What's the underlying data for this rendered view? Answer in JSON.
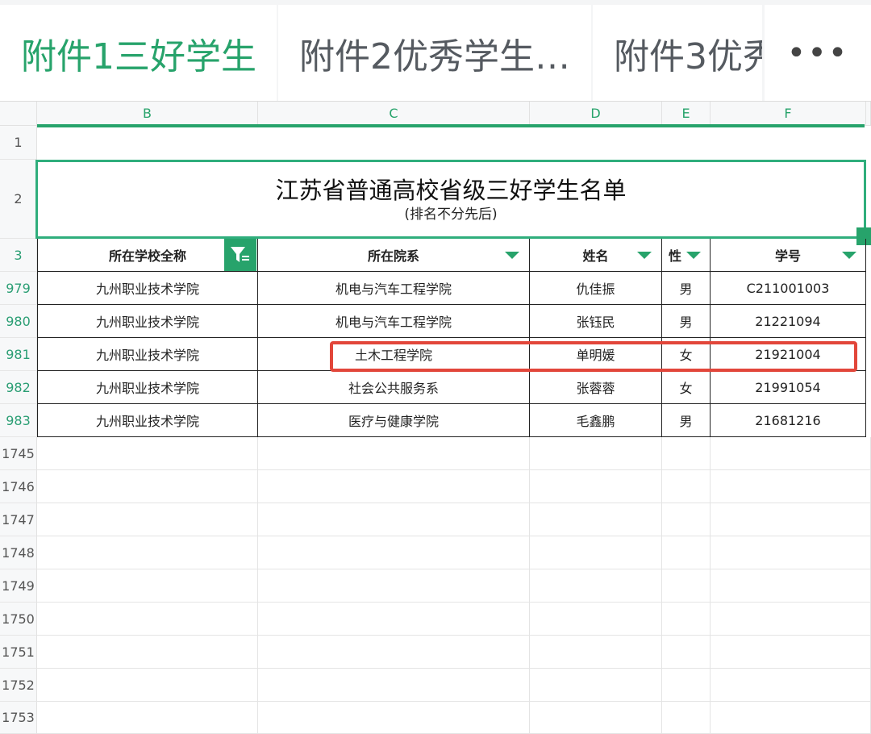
{
  "tabs": [
    {
      "label": "附件1三好学生",
      "active": true
    },
    {
      "label": "附件2优秀学生…",
      "active": false
    },
    {
      "label": "附件3优秀",
      "active": false
    }
  ],
  "more_label": "•••",
  "columns": [
    "B",
    "C",
    "D",
    "E",
    "F"
  ],
  "rows_top": [
    "1",
    "2",
    "3"
  ],
  "title": {
    "main": "江苏省普通高校省级三好学生名单",
    "sub": "(排名不分先后)"
  },
  "headers": [
    "所在学校全称",
    "所在院系",
    "姓名",
    "性",
    "学号"
  ],
  "data_rows": [
    {
      "num": "979",
      "school": "九州职业技术学院",
      "dept": "机电与汽车工程学院",
      "name": "仇佳振",
      "gender": "男",
      "id": "C211001003"
    },
    {
      "num": "980",
      "school": "九州职业技术学院",
      "dept": "机电与汽车工程学院",
      "name": "张钰民",
      "gender": "男",
      "id": "21221094"
    },
    {
      "num": "981",
      "school": "九州职业技术学院",
      "dept": "土木工程学院",
      "name": "单明媛",
      "gender": "女",
      "id": "21921004"
    },
    {
      "num": "982",
      "school": "九州职业技术学院",
      "dept": "社会公共服务系",
      "name": "张蓉蓉",
      "gender": "女",
      "id": "21991054"
    },
    {
      "num": "983",
      "school": "九州职业技术学院",
      "dept": "医疗与健康学院",
      "name": "毛鑫鹏",
      "gender": "男",
      "id": "21681216"
    }
  ],
  "empty_rows": [
    "1745",
    "1746",
    "1747",
    "1748",
    "1749",
    "1750",
    "1751",
    "1752",
    "1753"
  ],
  "colors": {
    "accent": "#27a36b",
    "highlight": "#e2463a"
  }
}
